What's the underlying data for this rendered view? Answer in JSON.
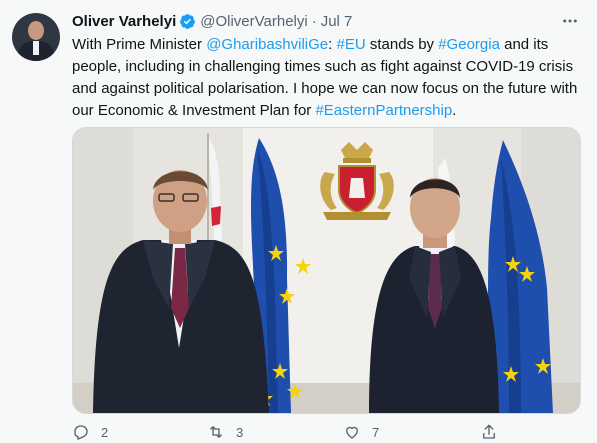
{
  "tweet": {
    "author_name": "Oliver Varhelyi",
    "handle": "@OliverVarhelyi",
    "separator": "·",
    "date": "Jul 7",
    "text": {
      "t1": "With Prime Minister ",
      "mention": "@GharibashviliGe",
      "t2": ": ",
      "hashtag_eu": "#EU",
      "t3": " stands by ",
      "hashtag_georgia": "#Georgia",
      "t4": " and its people, including in challenging times such as fight against COVID-19 crisis and against political polarisation. I hope we can now focus on the future with our Economic & Investment Plan for ",
      "hashtag_eap": "#EasternPartnership",
      "t5": "."
    }
  },
  "actions": {
    "reply_count": "2",
    "retweet_count": "3",
    "like_count": "7"
  },
  "icons": {
    "verified": "verified-badge-icon",
    "more": "more-options-icon",
    "reply": "reply-icon",
    "retweet": "retweet-icon",
    "like": "heart-icon",
    "share": "share-icon"
  },
  "colors": {
    "link": "#1d9bf0",
    "secondary_text": "#536471",
    "background": "#f7f9f9",
    "eu_flag_blue": "#1f4fae",
    "eu_star_yellow": "#f6d20a"
  }
}
